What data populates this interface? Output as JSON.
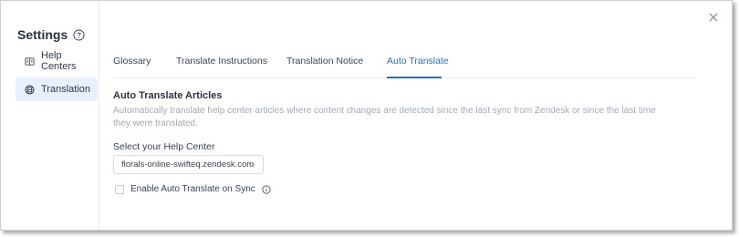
{
  "sidebar": {
    "title": "Settings",
    "items": [
      {
        "label": "Help Centers",
        "icon": "book-icon",
        "active": false
      },
      {
        "label": "Translation",
        "icon": "globe-icon",
        "active": true
      }
    ]
  },
  "tabs": [
    {
      "label": "Glossary",
      "active": false
    },
    {
      "label": "Translate Instructions",
      "active": false
    },
    {
      "label": "Translation Notice",
      "active": false
    },
    {
      "label": "Auto Translate",
      "active": true
    }
  ],
  "auto_translate": {
    "title": "Auto Translate Articles",
    "description": "Automatically translate help center articles where content changes are detected since the last sync from Zendesk or since the last time they were translated.",
    "help_center_label": "Select your Help Center",
    "help_center_value": "florals-online-swifteq.zendesk.com",
    "enable_label": "Enable Auto Translate on Sync",
    "enable_checked": false
  },
  "colors": {
    "accent": "#1f6fd1",
    "active_bg": "#e8f1fb",
    "muted_text": "#a2a9b3"
  }
}
